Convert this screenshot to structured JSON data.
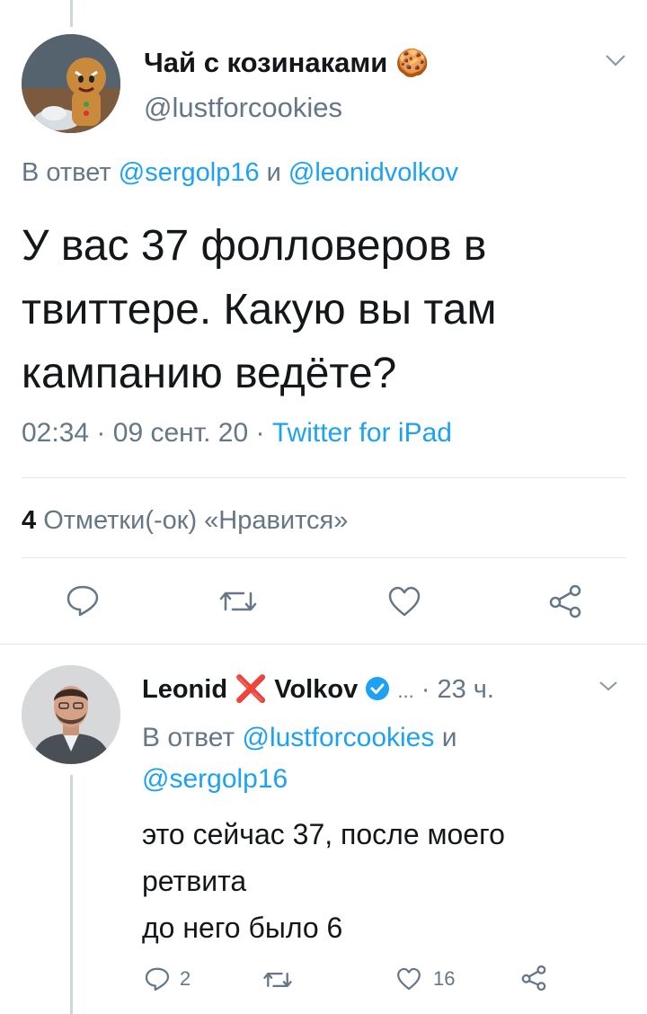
{
  "main_tweet": {
    "display_name": "Чай с козинаками",
    "name_emoji": "🍪",
    "handle": "@lustforcookies",
    "reply_prefix": "В ответ",
    "reply_user_1": "@sergolp16",
    "reply_and": "и",
    "reply_user_2": "@leonidvolkov",
    "text_lines": [
      "У вас 37 фолловеров в",
      "твиттере. Какую вы там",
      "кампанию ведёте?"
    ],
    "time": "02:34",
    "sep1": "·",
    "date": "09 сент. 20",
    "sep2": "·",
    "source": "Twitter for iPad",
    "likes_count": "4",
    "likes_label": "Отметки(-ок) «Нравится»",
    "icons": [
      "reply-icon",
      "retweet-icon",
      "like-icon",
      "share-icon",
      "chevron-down-icon"
    ]
  },
  "reply_tweet": {
    "name_first": "Leonid",
    "name_mark": "❌",
    "name_last": "Volkov",
    "dots": "...",
    "sep": "·",
    "time_ago": "23 ч.",
    "reply_prefix": "В ответ",
    "reply_user_1": "@lustforcookies",
    "reply_and": "и",
    "reply_user_2": "@sergolp16",
    "text_lines": [
      "это сейчас 37, после моего",
      "ретвита",
      "до него было 6"
    ],
    "reply_count": "2",
    "like_count": "16",
    "colors": {
      "link": "#1da1f2",
      "muted": "#657786",
      "mark": "#e0245e"
    }
  }
}
